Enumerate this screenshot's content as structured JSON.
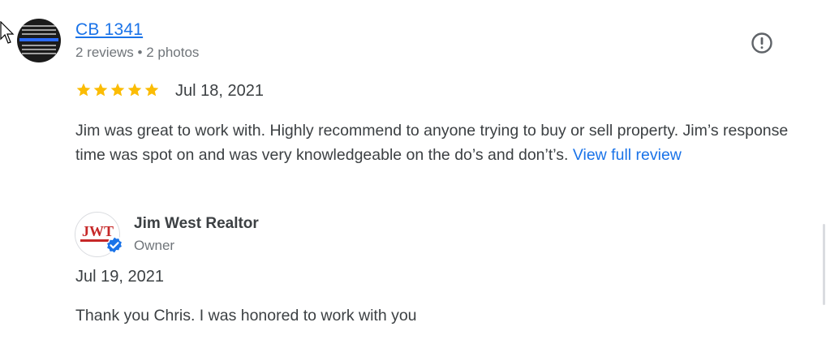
{
  "review": {
    "reviewer_name": "CB 1341",
    "reviewer_meta": "2 reviews • 2 photos",
    "rating": 5,
    "date": "Jul 18, 2021",
    "text": "Jim was great to work with. Highly recommend to anyone trying to buy or sell property. Jim’s response time was spot on and was very knowledgeable on the do’s and don’t’s.  ",
    "view_full_label": "View full review"
  },
  "owner_response": {
    "name": "Jim West Realtor",
    "role": "Owner",
    "date": "Jul 19, 2021",
    "text": "Thank you Chris. I was honored to work with you"
  },
  "colors": {
    "link": "#1a73e8",
    "star": "#fbbc04",
    "verified": "#1a73e8"
  },
  "icons": {
    "flag": "report-icon",
    "star": "star-icon",
    "verified": "verified-badge-icon"
  }
}
